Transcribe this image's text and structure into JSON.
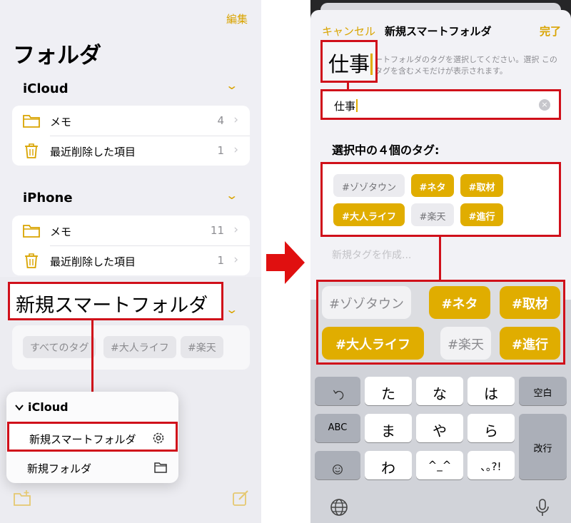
{
  "left": {
    "edit_label": "編集",
    "title": "フォルダ",
    "sections": [
      {
        "name": "iCloud",
        "rows": [
          {
            "label": "メモ",
            "count": "4",
            "icon": "folder-icon"
          },
          {
            "label": "最近削除した項目",
            "count": "1",
            "icon": "trash-icon"
          }
        ]
      },
      {
        "name": "iPhone",
        "rows": [
          {
            "label": "メモ",
            "count": "11",
            "icon": "folder-icon"
          },
          {
            "label": "最近削除した項目",
            "count": "1",
            "icon": "trash-icon"
          }
        ]
      }
    ],
    "smart_folder_label": "新規スマートフォルダ",
    "tags": [
      "すべてのタグ",
      "#大人ライフ",
      "#楽天"
    ],
    "context_menu": {
      "header": "iCloud",
      "items": [
        {
          "label": "新規スマートフォルダ",
          "icon": "gear-icon"
        },
        {
          "label": "新規フォルダ",
          "icon": "folder-icon"
        }
      ]
    },
    "chevron": "⌄",
    "row_arrow": "›"
  },
  "right": {
    "nav": {
      "cancel": "キャンセル",
      "title": "新規スマートフォルダ",
      "done": "完了"
    },
    "big_word": "仕事",
    "hint": "ートフォルダのタグを選択してください。選択 このタグを含むメモだけが表示されます。",
    "search_value": "仕事",
    "clear_glyph": "×",
    "selected_heading": "選択中の４個のタグ:",
    "selected_tags": [
      {
        "label": "#ゾゾタウン",
        "selected": false
      },
      {
        "label": "#ネタ",
        "selected": true
      },
      {
        "label": "#取材",
        "selected": true
      },
      {
        "label": "#大人ライフ",
        "selected": true
      },
      {
        "label": "#楽天",
        "selected": false
      },
      {
        "label": "#進行",
        "selected": true
      }
    ],
    "new_tag_placeholder": "新規タグを作成...",
    "keyboard": {
      "keys": [
        "た",
        "な",
        "は",
        "ま",
        "や",
        "ら",
        "わ",
        "^_^",
        "､｡?!"
      ],
      "space": "空白",
      "abc": "ABC",
      "return": "改行"
    }
  },
  "colors": {
    "accent": "#e0ad00",
    "annotation_red": "#d0101a"
  }
}
